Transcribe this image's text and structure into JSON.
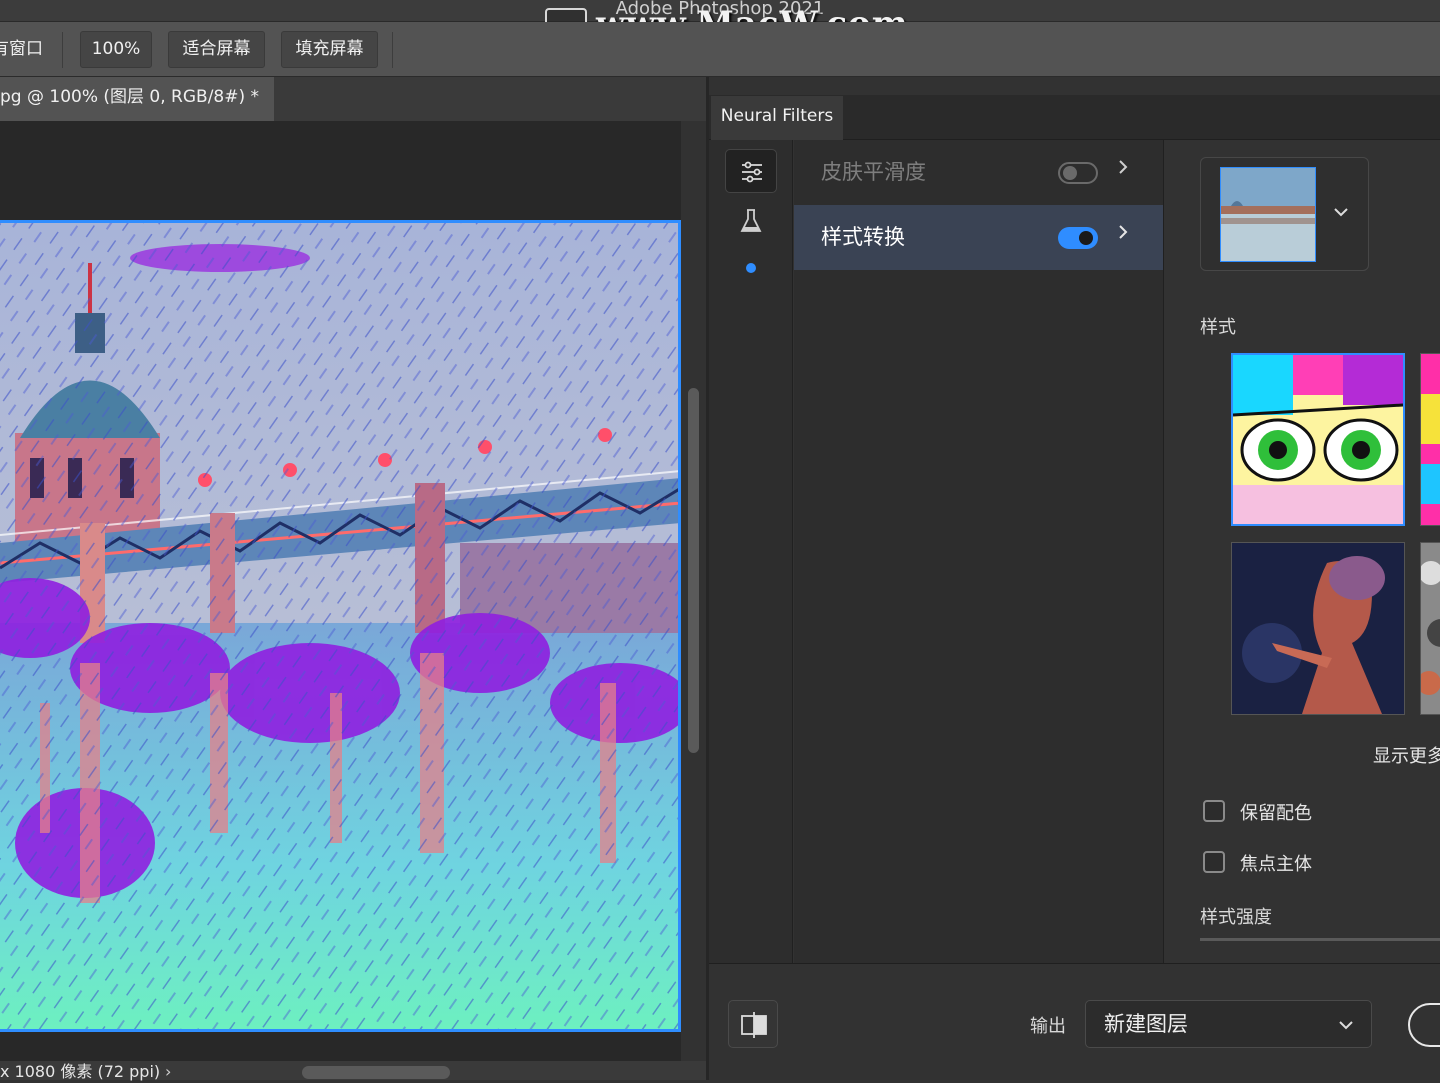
{
  "window": {
    "app_title": "Adobe Photoshop 2021",
    "watermark": "www.MacW.com"
  },
  "options_bar": {
    "buttons": [
      "有窗口",
      "100%",
      "适合屏幕",
      "填充屏幕"
    ]
  },
  "document": {
    "tab_title": "pg @ 100% (图层 0, RGB/8#) *",
    "status_text": "x 1080 像素 (72 ppi)",
    "status_arrow": "›"
  },
  "neural_filters": {
    "panel_title": "Neural Filters",
    "sidebar_icons": [
      "sliders-icon",
      "beaker-icon",
      "active-dot-icon"
    ],
    "filters": [
      {
        "label": "皮肤平滑度",
        "enabled": false
      },
      {
        "label": "样式转换",
        "enabled": true
      }
    ],
    "styles_label": "样式",
    "show_more": "显示更多",
    "options": [
      {
        "label": "保留配色",
        "checked": false
      },
      {
        "label": "焦点主体",
        "checked": false
      }
    ],
    "strength_label": "样式强度",
    "output_label": "输出",
    "output_value": "新建图层"
  },
  "colors": {
    "accent": "#2f8dff",
    "panel_bg": "#323232",
    "selected_row": "#3a4354"
  }
}
